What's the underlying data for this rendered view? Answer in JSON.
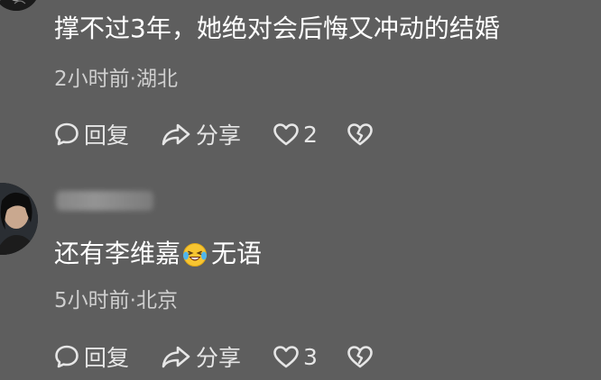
{
  "comments": [
    {
      "text": "撑不过3年，她绝对会后悔又冲动的结婚",
      "meta": "2小时前·湖北",
      "reply_label": "回复",
      "share_label": "分享",
      "like_count": "2"
    },
    {
      "text_before_emoji": "还有李维嘉",
      "emoji_name": "laughing-tears-emoji",
      "text_after_emoji": "无语",
      "meta": "5小时前·北京",
      "reply_label": "回复",
      "share_label": "分享",
      "like_count": "3"
    }
  ],
  "colors": {
    "background": "#5e5e5e",
    "text_primary": "#ffffff",
    "text_meta": "#cfcfcf",
    "icon": "#e6e6e6"
  },
  "icons": [
    "comment-bubble-icon",
    "share-arrow-icon",
    "heart-outline-icon",
    "broken-heart-icon"
  ]
}
